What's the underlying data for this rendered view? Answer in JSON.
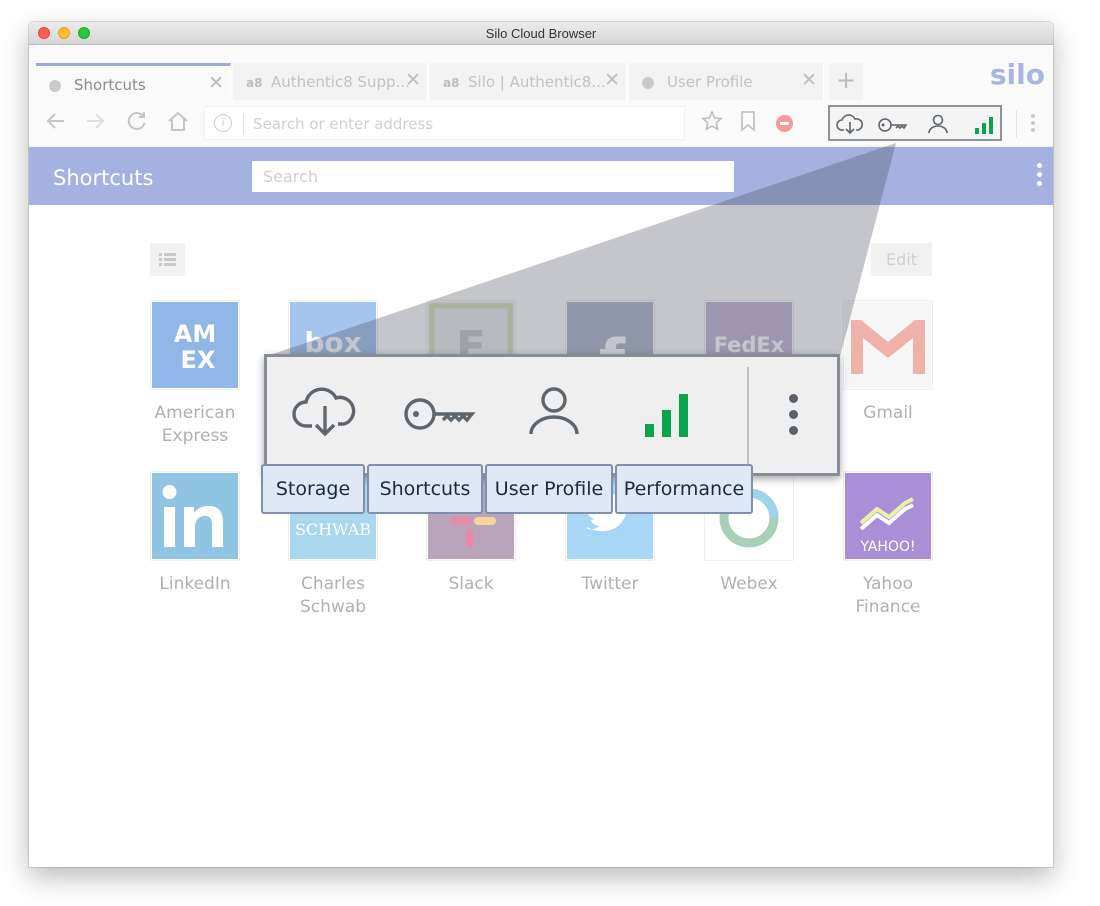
{
  "window": {
    "title": "Silo Cloud Browser"
  },
  "tabs": [
    {
      "label": "Shortcuts",
      "icon": "silo-tab-icon",
      "active": true
    },
    {
      "label": "Authentic8 Supp...",
      "icon": "authentic8-tab-icon",
      "active": false
    },
    {
      "label": "Silo | Authentic8...",
      "icon": "authentic8-tab-icon",
      "active": false
    },
    {
      "label": "User Profile",
      "icon": "silo-tab-icon",
      "active": false
    }
  ],
  "tab_icon_text": "a8",
  "tab_close_glyph": "✕",
  "new_tab_glyph": "+",
  "brand": "silo",
  "address_bar": {
    "placeholder": "Search or enter address",
    "info_glyph": "i"
  },
  "nav_icons": [
    "back-arrow-icon",
    "forward-arrow-icon",
    "reload-icon",
    "home-icon",
    "bookmark-star-icon",
    "bookmark-icon",
    "stop-icon"
  ],
  "header": {
    "title": "Shortcuts",
    "search_placeholder": "Search"
  },
  "edit_label": "Edit",
  "shortcuts": [
    {
      "name": "American Express",
      "line1": "American",
      "line2": "Express",
      "color": "#8fb6e6"
    },
    {
      "name": "Box",
      "color": "#a5c4ee"
    },
    {
      "name": "Evernote",
      "color": "#d9dfd2"
    },
    {
      "name": "Facebook",
      "color": "#b1bacc"
    },
    {
      "name": "FedEx",
      "color": "#c6b9d6"
    },
    {
      "name": "Gmail",
      "line1": "Gmail",
      "line2": "",
      "color": "#f1b1ab"
    },
    {
      "name": "LinkedIn",
      "line1": "LinkedIn",
      "line2": "",
      "color": "#8fc4e2"
    },
    {
      "name": "Charles Schwab",
      "line1": "Charles",
      "line2": "Schwab",
      "color": "#a9d7ee",
      "logo_text": "SCHWAB"
    },
    {
      "name": "Slack",
      "line1": "Slack",
      "line2": "",
      "color": "#b9a5b9"
    },
    {
      "name": "Twitter",
      "line1": "Twitter",
      "line2": "",
      "color": "#a8d6f5"
    },
    {
      "name": "Webex",
      "line1": "Webex",
      "line2": "",
      "color": "#ffffff"
    },
    {
      "name": "Yahoo Finance",
      "line1": "Yahoo",
      "line2": "Finance",
      "color": "#a98fd6",
      "logo_text": "YAHOO!"
    }
  ],
  "toolbar_zoom": {
    "items": [
      {
        "label": "Storage",
        "icon": "cloud-download-icon"
      },
      {
        "label": "Shortcuts",
        "icon": "key-icon"
      },
      {
        "label": "User Profile",
        "icon": "user-icon"
      },
      {
        "label": "Performance",
        "icon": "signal-bars-icon"
      }
    ],
    "performance_color": "#0aa54a",
    "icon_color": "#5e656c"
  },
  "colors": {
    "header": "#a4b2e2",
    "callout_label_bg": "#dfe8f6",
    "callout_border": "#7e90ad"
  }
}
